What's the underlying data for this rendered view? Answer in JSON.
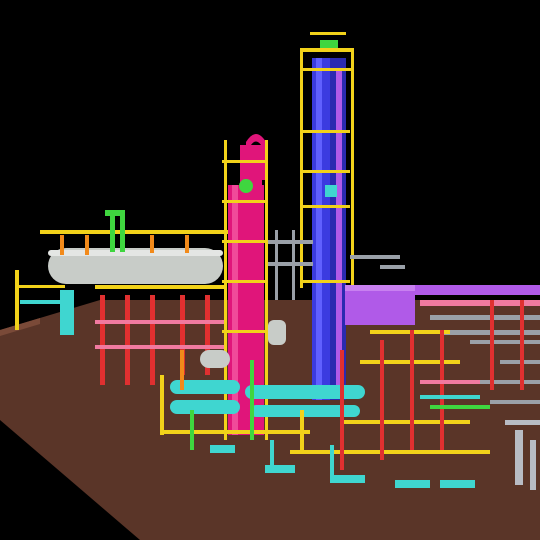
{
  "scene": {
    "background": "#000000",
    "colors": {
      "ground": "#5a3528",
      "ground_edge": "#7a4a38",
      "column_blue": "#3b3be0",
      "column_magenta": "#e0157a",
      "vessel_grey": "#c8ccc8",
      "pipe_cyan": "#3fd6d0",
      "pipe_yellow": "#f2d21a",
      "pipe_green": "#3fd63f",
      "pipe_red": "#e03030",
      "pipe_purple": "#b05ae8",
      "pipe_orange": "#f28a1a",
      "steel_grey": "#9aa0a8",
      "platform_pink": "#f07aa0"
    }
  }
}
